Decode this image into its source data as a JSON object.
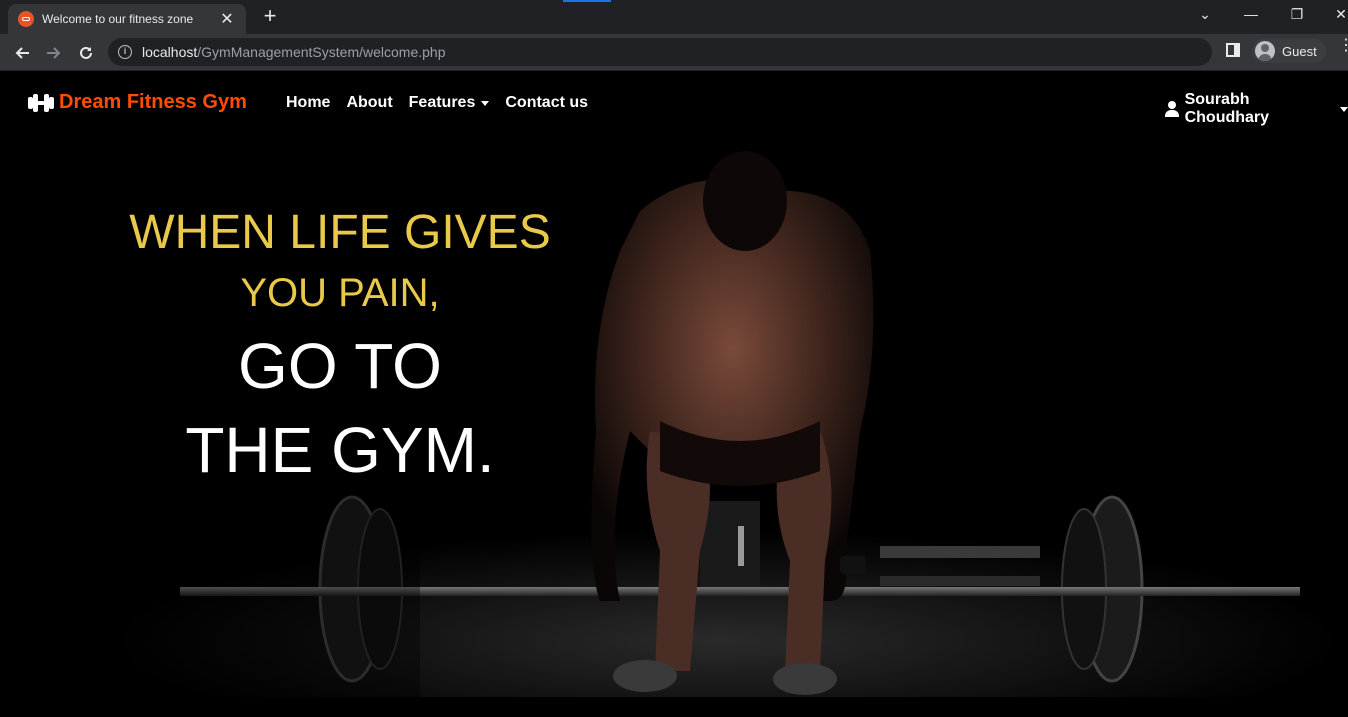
{
  "browser": {
    "tab_title": "Welcome to our fitness zone",
    "url_host": "localhost",
    "url_path": "/GymManagementSystem/welcome.php",
    "profile_label": "Guest"
  },
  "site": {
    "brand": "Dream Fitness Gym",
    "brand_color": "#ff4d00",
    "nav": {
      "home": "Home",
      "about": "About",
      "features": "Features",
      "contact": "Contact us"
    },
    "user_name": "Sourabh Choudhary"
  },
  "hero": {
    "line1": "WHEN LIFE GIVES",
    "line2": "YOU PAIN,",
    "line3": "GO TO",
    "line4": "THE GYM.",
    "accent_color": "#e8c94a"
  }
}
